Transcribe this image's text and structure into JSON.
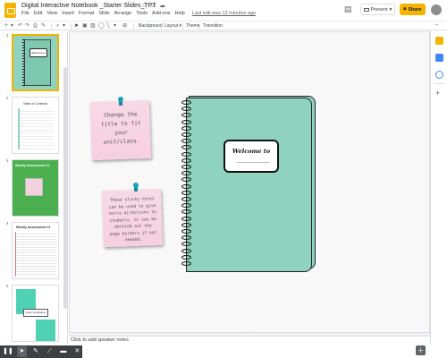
{
  "document": {
    "title": "Digital Interactive Notebook _Starter Slides_TPT",
    "last_edit": "Last edit was 13 minutes ago"
  },
  "menu": [
    "File",
    "Edit",
    "View",
    "Insert",
    "Format",
    "Slide",
    "Arrange",
    "Tools",
    "Add-ons",
    "Help"
  ],
  "header": {
    "present_label": "Present",
    "share_label": "Share"
  },
  "toolbar": {
    "background_label": "Background",
    "layout_label": "Layout ▾",
    "theme_label": "Theme",
    "transition_label": "Transition"
  },
  "filmstrip": {
    "numbers": [
      "1",
      "2",
      "3",
      "4",
      "5"
    ],
    "thumb1_label": "Welcome to",
    "thumb2_heading": "Table of Contents",
    "thumb3_heading": "Weekly Assessment #1",
    "thumb4_heading": "Weekly Assessment #2",
    "thumb5_label": "Topic Vocabulary"
  },
  "slide": {
    "sticky1_text": "Change the title to fit your unit/class.",
    "sticky2_text": "These sticky notes can be used to give extra directions to students, or can be deleted out the page borders if not needed.",
    "notebook_title": "Welcome to",
    "notebook_line": "_______________"
  },
  "speaker_notes": {
    "placeholder": "Click to add speaker notes"
  },
  "colors": {
    "accent": "#f4b400",
    "notebook": "#8fd3be",
    "sticky": "#f6cfe0",
    "pin": "#1aa3b8"
  }
}
